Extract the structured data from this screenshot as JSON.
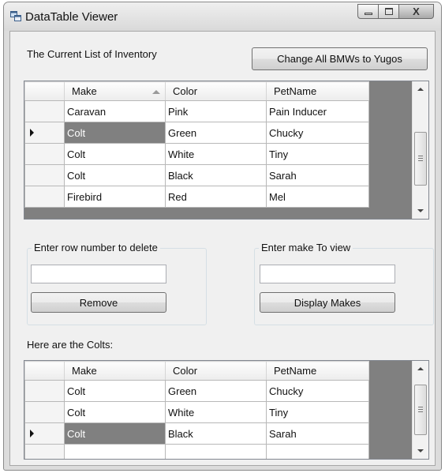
{
  "window": {
    "title": "DataTable Viewer",
    "close_glyph": "X"
  },
  "inventory": {
    "label": "The Current List of Inventory",
    "change_button": "Change All BMWs to Yugos",
    "columns": [
      "Make",
      "Color",
      "PetName"
    ],
    "sort_column": "Make",
    "sort_direction": "ascending",
    "rows": [
      {
        "make": "Caravan",
        "color": "Pink",
        "petname": "Pain Inducer"
      },
      {
        "make": "Colt",
        "color": "Green",
        "petname": "Chucky"
      },
      {
        "make": "Colt",
        "color": "White",
        "petname": "Tiny"
      },
      {
        "make": "Colt",
        "color": "Black",
        "petname": "Sarah"
      },
      {
        "make": "Firebird",
        "color": "Red",
        "petname": "Mel"
      }
    ],
    "current_row": 2,
    "selected_cell": "make"
  },
  "delete_group": {
    "title": "Enter row number to delete",
    "input_value": "",
    "button": "Remove"
  },
  "view_group": {
    "title": "Enter make To view",
    "input_value": "",
    "button": "Display Makes"
  },
  "colts": {
    "label": "Here are the Colts:",
    "columns": [
      "Make",
      "Color",
      "PetName"
    ],
    "rows": [
      {
        "make": "Colt",
        "color": "Green",
        "petname": "Chucky"
      },
      {
        "make": "Colt",
        "color": "White",
        "petname": "Tiny"
      },
      {
        "make": "Colt",
        "color": "Black",
        "petname": "Sarah"
      }
    ],
    "current_row": 3,
    "selected_cell": "make"
  },
  "colors": {
    "selection": "#808080",
    "grid_background": "#808080",
    "form_background": "#f0f0f0"
  },
  "icons": [
    "app-icon",
    "minimize-icon",
    "maximize-icon",
    "close-icon",
    "current-row-arrow-icon",
    "sort-ascending-icon",
    "scroll-up-icon",
    "scroll-down-icon",
    "scroll-thumb-grip-icon"
  ]
}
